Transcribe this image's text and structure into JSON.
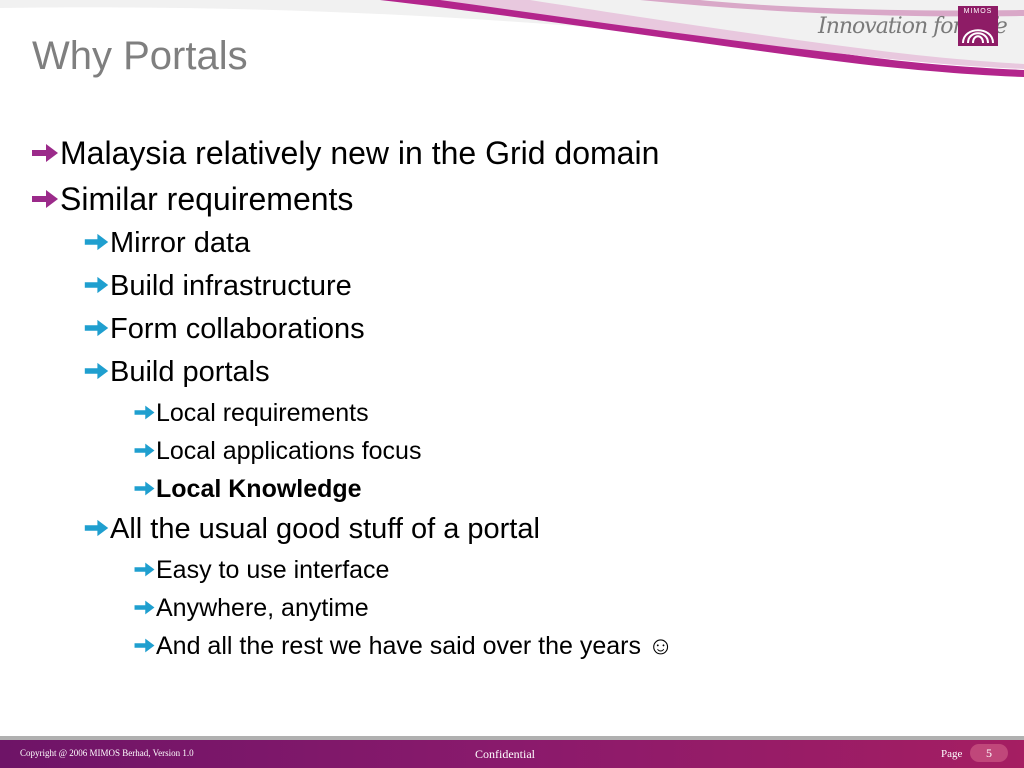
{
  "slide": {
    "title": "Why Portals",
    "brand": {
      "tagline": "Innovation for Life",
      "logo_text": "MIMOS"
    },
    "colors": {
      "arrow_level1": "#9b2a8a",
      "arrow_level2": "#1f9fcf",
      "title": "#7f7f7f",
      "footer": "#8a1a6c"
    },
    "bullets": [
      {
        "level": 1,
        "text": "Malaysia relatively new in the Grid domain",
        "icon": "arrow-right-icon"
      },
      {
        "level": 1,
        "text": "Similar requirements",
        "icon": "arrow-right-icon"
      },
      {
        "level": 2,
        "text": "Mirror data",
        "icon": "arrow-right-icon"
      },
      {
        "level": 2,
        "text": "Build infrastructure",
        "icon": "arrow-right-icon"
      },
      {
        "level": 2,
        "text": "Form collaborations",
        "icon": "arrow-right-icon"
      },
      {
        "level": 2,
        "text": "Build portals",
        "icon": "arrow-right-icon"
      },
      {
        "level": 3,
        "text": "Local requirements",
        "icon": "arrow-right-icon"
      },
      {
        "level": 3,
        "text": "Local applications focus",
        "icon": "arrow-right-icon"
      },
      {
        "level": 3,
        "text": "Local Knowledge",
        "bold": true,
        "icon": "arrow-right-icon"
      },
      {
        "level": 2,
        "text": "All the usual good stuff of a portal",
        "icon": "arrow-right-icon"
      },
      {
        "level": 3,
        "text": "Easy to use interface",
        "icon": "arrow-right-icon"
      },
      {
        "level": 3,
        "text": "Anywhere, anytime",
        "icon": "arrow-right-icon"
      },
      {
        "level": 3,
        "text": "And all the rest we have said over the years ☺",
        "icon": "arrow-right-icon"
      }
    ],
    "footer": {
      "copyright": "Copyright @ 2006 MIMOS Berhad, Version 1.0",
      "confidential": "Confidential",
      "page_label": "Page",
      "page_number": "5"
    }
  }
}
